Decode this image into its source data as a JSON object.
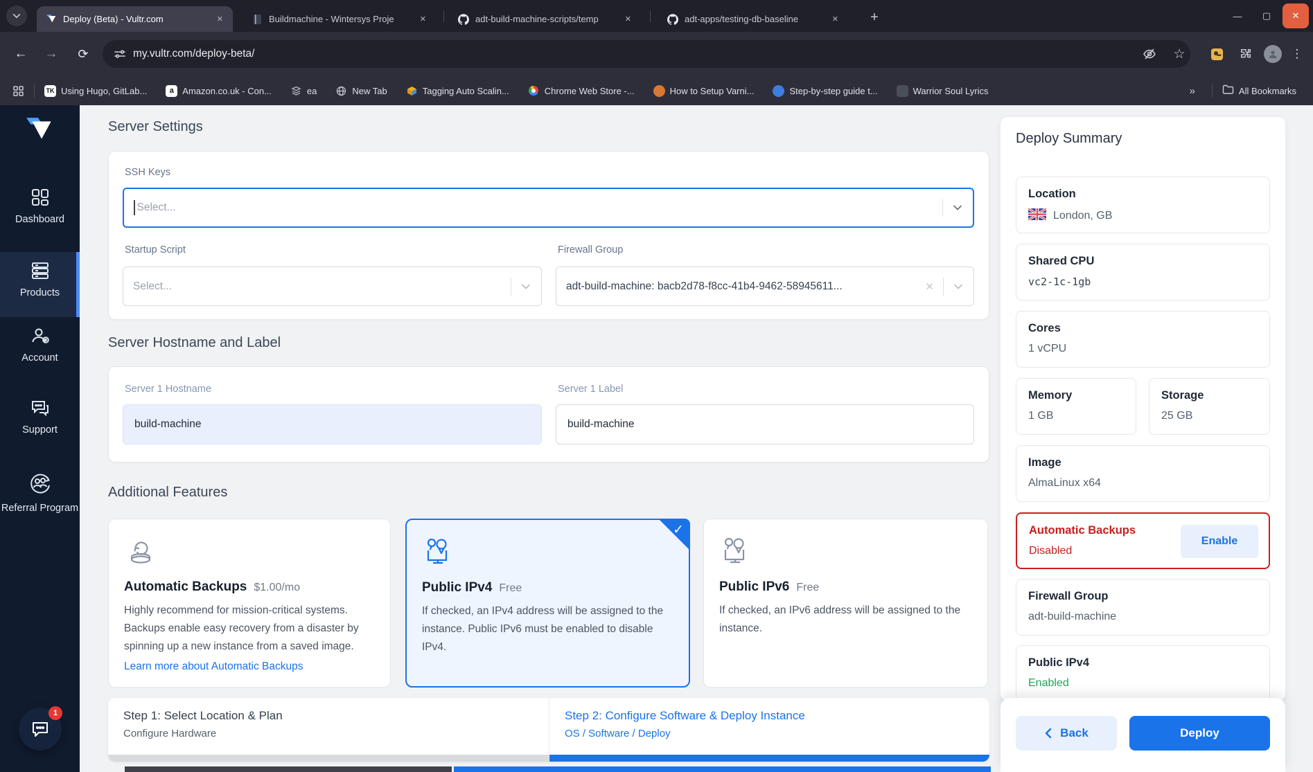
{
  "browser": {
    "tabs": [
      {
        "title": "Deploy (Beta) - Vultr.com",
        "icon": "vultr"
      },
      {
        "title": "Buildmachine - Wintersys Proje",
        "icon": "notebook"
      },
      {
        "title": "adt-build-machine-scripts/temp",
        "icon": "github"
      },
      {
        "title": "adt-apps/testing-db-baseline",
        "icon": "github"
      }
    ],
    "url": "my.vultr.com/deploy-beta/",
    "bookmarks": [
      {
        "label": "Using Hugo, GitLab...",
        "glyph": "TK"
      },
      {
        "label": "Amazon.co.uk - Con...",
        "glyph": "a"
      },
      {
        "label": "ea",
        "glyph": ""
      },
      {
        "label": "New Tab",
        "glyph": ""
      },
      {
        "label": "Tagging Auto Scalin...",
        "glyph": ""
      },
      {
        "label": "Chrome Web Store -...",
        "glyph": ""
      },
      {
        "label": "How to Setup Varni...",
        "glyph": ""
      },
      {
        "label": "Step-by-step guide t...",
        "glyph": ""
      },
      {
        "label": "Warrior Soul Lyrics",
        "glyph": ""
      }
    ],
    "all_bookmarks": "All Bookmarks"
  },
  "sidebar": {
    "items": [
      {
        "label": "Dashboard"
      },
      {
        "label": "Products",
        "active": true
      },
      {
        "label": "Account"
      },
      {
        "label": "Support"
      },
      {
        "label": "Referral Program"
      }
    ],
    "chat_badge": "1"
  },
  "server_settings": {
    "heading": "Server Settings",
    "ssh": {
      "label": "SSH Keys",
      "placeholder": "Select..."
    },
    "startup": {
      "label": "Startup Script",
      "placeholder": "Select..."
    },
    "firewall": {
      "label": "Firewall Group",
      "value": "adt-build-machine: bacb2d78-f8cc-41b4-9462-58945611..."
    }
  },
  "hostname_section": {
    "heading": "Server Hostname and Label",
    "hostname": {
      "label": "Server 1 Hostname",
      "value": "build-machine"
    },
    "label": {
      "label": "Server 1 Label",
      "value": "build-machine"
    }
  },
  "features": {
    "heading": "Additional Features",
    "cards": [
      {
        "title": "Automatic Backups",
        "price": "$1.00/mo",
        "desc": "Highly recommend for mission-critical systems. Backups enable easy recovery from a disaster by spinning up a new instance from a saved image.",
        "link": "Learn more about Automatic Backups",
        "selected": false
      },
      {
        "title": "Public IPv4",
        "price": "Free",
        "desc": "If checked, an IPv4 address will be assigned to the instance. Public IPv6 must be enabled to disable IPv4.",
        "selected": true
      },
      {
        "title": "Public IPv6",
        "price": "Free",
        "desc": "If checked, an IPv6 address will be assigned to the instance.",
        "selected": false
      }
    ]
  },
  "steps": {
    "step1": {
      "title": "Step 1: Select Location & Plan",
      "subtitle": "Configure Hardware"
    },
    "step2": {
      "title": "Step 2: Configure Software & Deploy Instance",
      "subtitle": "OS / Software / Deploy"
    }
  },
  "summary": {
    "title": "Deploy Summary",
    "location": {
      "label": "Location",
      "value": "London, GB"
    },
    "plan": {
      "label": "Shared CPU",
      "value": "vc2-1c-1gb"
    },
    "cores": {
      "label": "Cores",
      "value": "1 vCPU"
    },
    "memory": {
      "label": "Memory",
      "value": "1 GB"
    },
    "storage": {
      "label": "Storage",
      "value": "25 GB"
    },
    "image": {
      "label": "Image",
      "value": "AlmaLinux x64"
    },
    "backups": {
      "label": "Automatic Backups",
      "value": "Disabled",
      "action": "Enable"
    },
    "firewall": {
      "label": "Firewall Group",
      "value": "adt-build-machine"
    },
    "ipv4": {
      "label": "Public IPv4",
      "value": "Enabled"
    }
  },
  "footer": {
    "back_label": "Back",
    "deploy_label": "Deploy"
  },
  "colors": {
    "accent": "#1a73e8",
    "danger": "#c81e1e",
    "success": "#23a455",
    "selected_bg": "#eef5ff",
    "sidebar_bg": "#111b2e"
  }
}
